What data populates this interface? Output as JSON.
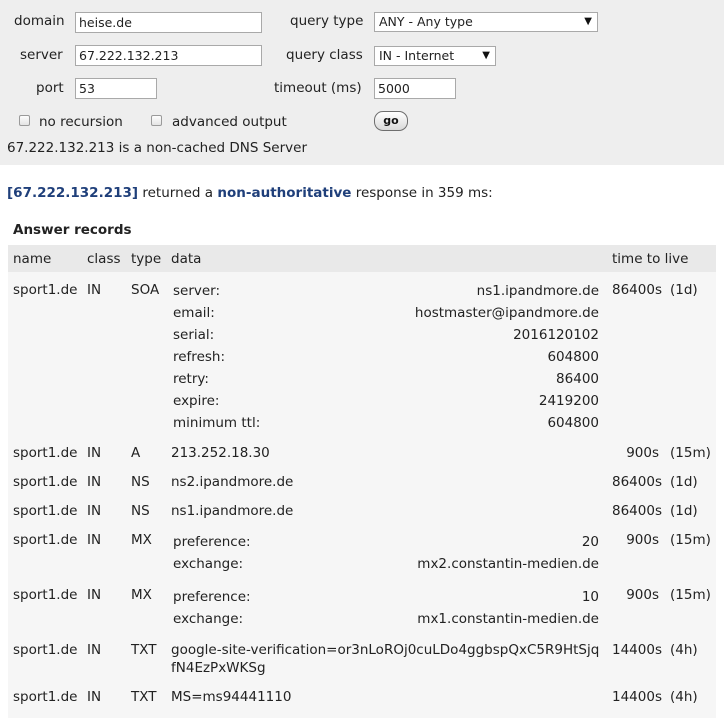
{
  "form": {
    "domain_label": "domain",
    "domain_value": "heise.de",
    "server_label": "server",
    "server_value": "67.222.132.213",
    "port_label": "port",
    "port_value": "53",
    "query_type_label": "query type",
    "query_type_value": "ANY - Any type",
    "query_class_label": "query class",
    "query_class_value": "IN - Internet",
    "timeout_label": "timeout (ms)",
    "timeout_value": "5000",
    "no_recursion_label": "no recursion",
    "advanced_output_label": "advanced output",
    "go_label": "go"
  },
  "status_text": "67.222.132.213 is a non-cached DNS Server",
  "result": {
    "server": "[67.222.132.213]",
    "returned_text": " returned a ",
    "authority": "non-authoritative",
    "response_text": " response in 359 ms:"
  },
  "answer_title": "Answer records",
  "columns": [
    "name",
    "class",
    "type",
    "data",
    "time to live"
  ],
  "records": [
    {
      "name": "sport1.de",
      "class": "IN",
      "type": "SOA",
      "fields": [
        {
          "k": "server:",
          "v": "ns1.ipandmore.de"
        },
        {
          "k": "email:",
          "v": "hostmaster@ipandmore.de"
        },
        {
          "k": "serial:",
          "v": "2016120102"
        },
        {
          "k": "refresh:",
          "v": "604800"
        },
        {
          "k": "retry:",
          "v": "86400"
        },
        {
          "k": "expire:",
          "v": "2419200"
        },
        {
          "k": "minimum ttl:",
          "v": "604800"
        }
      ],
      "ttl": "86400s",
      "ttl_h": "(1d)"
    },
    {
      "name": "sport1.de",
      "class": "IN",
      "type": "A",
      "data": "213.252.18.30",
      "ttl": "900s",
      "ttl_h": "(15m)"
    },
    {
      "name": "sport1.de",
      "class": "IN",
      "type": "NS",
      "data": "ns2.ipandmore.de",
      "ttl": "86400s",
      "ttl_h": "(1d)"
    },
    {
      "name": "sport1.de",
      "class": "IN",
      "type": "NS",
      "data": "ns1.ipandmore.de",
      "ttl": "86400s",
      "ttl_h": "(1d)"
    },
    {
      "name": "sport1.de",
      "class": "IN",
      "type": "MX",
      "fields": [
        {
          "k": "preference:",
          "v": "20"
        },
        {
          "k": "exchange:",
          "v": "mx2.constantin-medien.de"
        }
      ],
      "ttl": "900s",
      "ttl_h": "(15m)"
    },
    {
      "name": "sport1.de",
      "class": "IN",
      "type": "MX",
      "fields": [
        {
          "k": "preference:",
          "v": "10"
        },
        {
          "k": "exchange:",
          "v": "mx1.constantin-medien.de"
        }
      ],
      "ttl": "900s",
      "ttl_h": "(15m)"
    },
    {
      "name": "sport1.de",
      "class": "IN",
      "type": "TXT",
      "data": "google-site-verification=or3nLoROj0cuLDo4ggbspQxC5R9HtSjqfN4EzPxWKSg",
      "ttl": "14400s",
      "ttl_h": "(4h)"
    },
    {
      "name": "sport1.de",
      "class": "IN",
      "type": "TXT",
      "data": "MS=ms94441110",
      "ttl": "14400s",
      "ttl_h": "(4h)"
    }
  ]
}
